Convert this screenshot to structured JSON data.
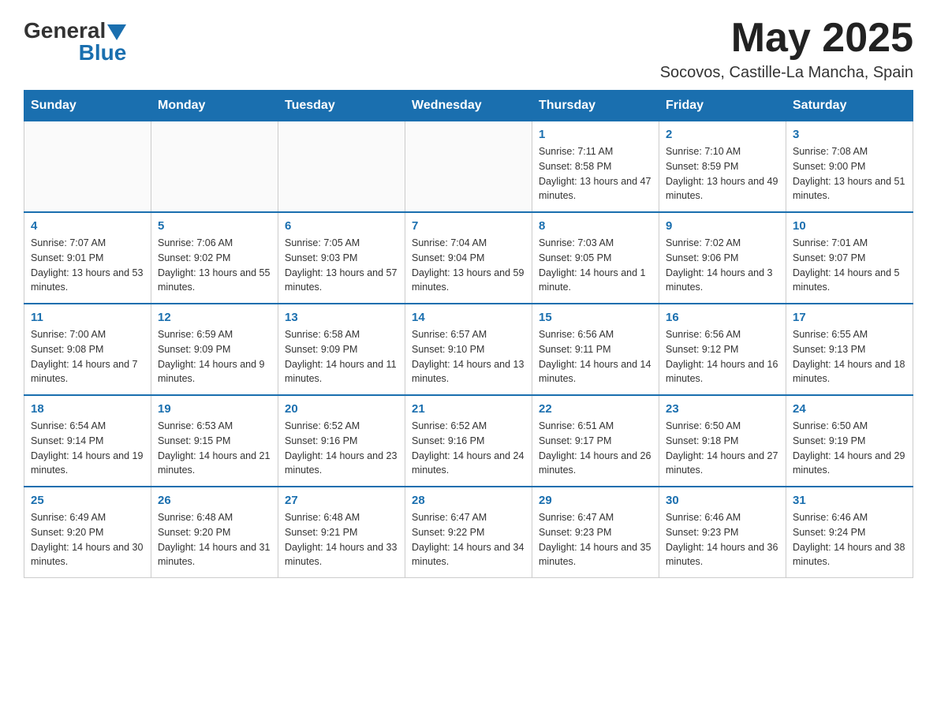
{
  "header": {
    "logo_general": "General",
    "logo_triangle": "",
    "logo_blue": "Blue",
    "month_year": "May 2025",
    "location": "Socovos, Castille-La Mancha, Spain"
  },
  "calendar": {
    "days_of_week": [
      "Sunday",
      "Monday",
      "Tuesday",
      "Wednesday",
      "Thursday",
      "Friday",
      "Saturday"
    ],
    "weeks": [
      [
        {
          "day": "",
          "info": ""
        },
        {
          "day": "",
          "info": ""
        },
        {
          "day": "",
          "info": ""
        },
        {
          "day": "",
          "info": ""
        },
        {
          "day": "1",
          "info": "Sunrise: 7:11 AM\nSunset: 8:58 PM\nDaylight: 13 hours and 47 minutes."
        },
        {
          "day": "2",
          "info": "Sunrise: 7:10 AM\nSunset: 8:59 PM\nDaylight: 13 hours and 49 minutes."
        },
        {
          "day": "3",
          "info": "Sunrise: 7:08 AM\nSunset: 9:00 PM\nDaylight: 13 hours and 51 minutes."
        }
      ],
      [
        {
          "day": "4",
          "info": "Sunrise: 7:07 AM\nSunset: 9:01 PM\nDaylight: 13 hours and 53 minutes."
        },
        {
          "day": "5",
          "info": "Sunrise: 7:06 AM\nSunset: 9:02 PM\nDaylight: 13 hours and 55 minutes."
        },
        {
          "day": "6",
          "info": "Sunrise: 7:05 AM\nSunset: 9:03 PM\nDaylight: 13 hours and 57 minutes."
        },
        {
          "day": "7",
          "info": "Sunrise: 7:04 AM\nSunset: 9:04 PM\nDaylight: 13 hours and 59 minutes."
        },
        {
          "day": "8",
          "info": "Sunrise: 7:03 AM\nSunset: 9:05 PM\nDaylight: 14 hours and 1 minute."
        },
        {
          "day": "9",
          "info": "Sunrise: 7:02 AM\nSunset: 9:06 PM\nDaylight: 14 hours and 3 minutes."
        },
        {
          "day": "10",
          "info": "Sunrise: 7:01 AM\nSunset: 9:07 PM\nDaylight: 14 hours and 5 minutes."
        }
      ],
      [
        {
          "day": "11",
          "info": "Sunrise: 7:00 AM\nSunset: 9:08 PM\nDaylight: 14 hours and 7 minutes."
        },
        {
          "day": "12",
          "info": "Sunrise: 6:59 AM\nSunset: 9:09 PM\nDaylight: 14 hours and 9 minutes."
        },
        {
          "day": "13",
          "info": "Sunrise: 6:58 AM\nSunset: 9:09 PM\nDaylight: 14 hours and 11 minutes."
        },
        {
          "day": "14",
          "info": "Sunrise: 6:57 AM\nSunset: 9:10 PM\nDaylight: 14 hours and 13 minutes."
        },
        {
          "day": "15",
          "info": "Sunrise: 6:56 AM\nSunset: 9:11 PM\nDaylight: 14 hours and 14 minutes."
        },
        {
          "day": "16",
          "info": "Sunrise: 6:56 AM\nSunset: 9:12 PM\nDaylight: 14 hours and 16 minutes."
        },
        {
          "day": "17",
          "info": "Sunrise: 6:55 AM\nSunset: 9:13 PM\nDaylight: 14 hours and 18 minutes."
        }
      ],
      [
        {
          "day": "18",
          "info": "Sunrise: 6:54 AM\nSunset: 9:14 PM\nDaylight: 14 hours and 19 minutes."
        },
        {
          "day": "19",
          "info": "Sunrise: 6:53 AM\nSunset: 9:15 PM\nDaylight: 14 hours and 21 minutes."
        },
        {
          "day": "20",
          "info": "Sunrise: 6:52 AM\nSunset: 9:16 PM\nDaylight: 14 hours and 23 minutes."
        },
        {
          "day": "21",
          "info": "Sunrise: 6:52 AM\nSunset: 9:16 PM\nDaylight: 14 hours and 24 minutes."
        },
        {
          "day": "22",
          "info": "Sunrise: 6:51 AM\nSunset: 9:17 PM\nDaylight: 14 hours and 26 minutes."
        },
        {
          "day": "23",
          "info": "Sunrise: 6:50 AM\nSunset: 9:18 PM\nDaylight: 14 hours and 27 minutes."
        },
        {
          "day": "24",
          "info": "Sunrise: 6:50 AM\nSunset: 9:19 PM\nDaylight: 14 hours and 29 minutes."
        }
      ],
      [
        {
          "day": "25",
          "info": "Sunrise: 6:49 AM\nSunset: 9:20 PM\nDaylight: 14 hours and 30 minutes."
        },
        {
          "day": "26",
          "info": "Sunrise: 6:48 AM\nSunset: 9:20 PM\nDaylight: 14 hours and 31 minutes."
        },
        {
          "day": "27",
          "info": "Sunrise: 6:48 AM\nSunset: 9:21 PM\nDaylight: 14 hours and 33 minutes."
        },
        {
          "day": "28",
          "info": "Sunrise: 6:47 AM\nSunset: 9:22 PM\nDaylight: 14 hours and 34 minutes."
        },
        {
          "day": "29",
          "info": "Sunrise: 6:47 AM\nSunset: 9:23 PM\nDaylight: 14 hours and 35 minutes."
        },
        {
          "day": "30",
          "info": "Sunrise: 6:46 AM\nSunset: 9:23 PM\nDaylight: 14 hours and 36 minutes."
        },
        {
          "day": "31",
          "info": "Sunrise: 6:46 AM\nSunset: 9:24 PM\nDaylight: 14 hours and 38 minutes."
        }
      ]
    ]
  }
}
